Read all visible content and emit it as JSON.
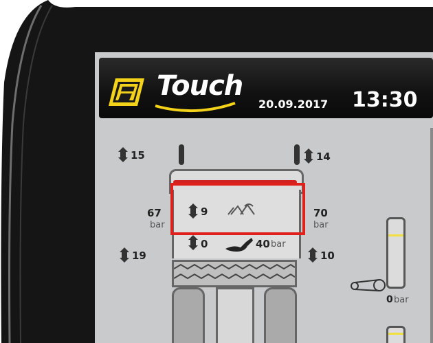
{
  "brand": {
    "logo_text": "Touch"
  },
  "header": {
    "date": "20.09.2017",
    "time": "13:30"
  },
  "wheels": {
    "top_left": {
      "value": "15"
    },
    "top_right": {
      "value": "14"
    },
    "bottom_left": {
      "value": "19"
    },
    "bottom_right": {
      "value": "10"
    }
  },
  "pressure": {
    "left": {
      "value": "67",
      "unit": "bar"
    },
    "right": {
      "value": "70",
      "unit": "bar"
    }
  },
  "center": {
    "depth_value": "9",
    "lower_value": "0",
    "load_value": "40",
    "load_unit": "bar"
  },
  "gauge": {
    "value": "0",
    "unit": "bar"
  },
  "colors": {
    "highlight": "#e0201b",
    "accent": "#f4d21a",
    "background": "#c9cacb"
  },
  "icons": [
    "updown-arrow-icon",
    "wheel-icon",
    "crop-icon",
    "seat-icon",
    "belt-pulley-icon"
  ]
}
